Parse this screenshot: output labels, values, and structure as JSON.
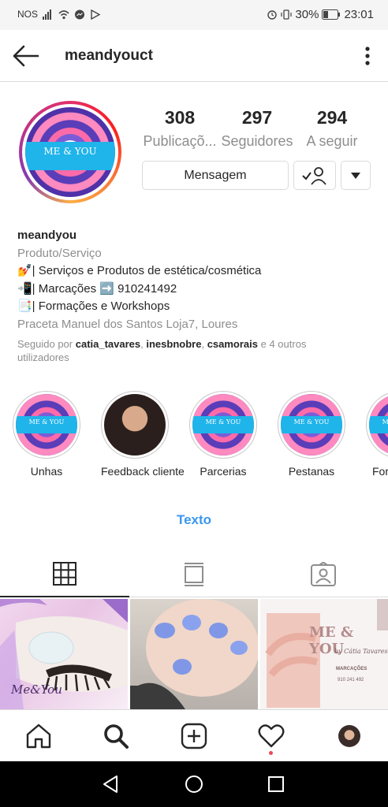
{
  "status_bar": {
    "carrier": "NOS",
    "battery": "30%",
    "time": "23:01"
  },
  "header": {
    "username": "meandyouct",
    "back_icon": "back-arrow-icon",
    "more_icon": "more-vertical-icon"
  },
  "profile": {
    "avatar_text": "ME & YOU",
    "stats": [
      {
        "value": "308",
        "label": "Publicaçõ..."
      },
      {
        "value": "297",
        "label": "Seguidores"
      },
      {
        "value": "294",
        "label": "A seguir"
      }
    ],
    "message_button": "Mensagem",
    "following_icon": "person-check-icon",
    "dropdown_icon": "caret-down-icon"
  },
  "bio": {
    "name": "meandyou",
    "category": "Produto/Serviço",
    "lines": [
      "💅| Serviços e Produtos de estética/cosmética",
      "📲| Marcações ➡️ 910241492",
      "📑| Formações e Workshops"
    ],
    "address": "Praceta Manuel dos Santos Loja7, Loures",
    "followed_prefix": "Seguido por ",
    "followed_users": [
      "catia_tavares",
      "inesbnobre",
      "csamorais"
    ],
    "followed_suffix": " e 4 outros utilizadores"
  },
  "highlights": [
    {
      "label": "Unhas"
    },
    {
      "label": "Feedback cliente"
    },
    {
      "label": "Parcerias"
    },
    {
      "label": "Pestanas"
    },
    {
      "label": "For"
    }
  ],
  "texto_link": "Texto",
  "tabs": [
    {
      "icon": "grid-icon",
      "active": true
    },
    {
      "icon": "feed-icon",
      "active": false
    },
    {
      "icon": "tagged-icon",
      "active": false
    }
  ],
  "grid_posts": [
    {
      "caption": "Me&You"
    },
    {
      "caption": ""
    },
    {
      "caption": "ME & YOU",
      "sub": "by Cátia Tavares",
      "extra": "MARCAÇÕES",
      "phone": "910 241 492"
    }
  ],
  "bottom_nav": [
    {
      "icon": "home-icon"
    },
    {
      "icon": "search-icon"
    },
    {
      "icon": "add-post-icon"
    },
    {
      "icon": "activity-heart-icon"
    },
    {
      "icon": "profile-avatar-icon"
    }
  ],
  "colors": {
    "link": "#3897f0",
    "muted": "#8e8e8e",
    "text": "#262626",
    "brand_blue": "#1fb4ea",
    "notif": "#ed4956"
  }
}
